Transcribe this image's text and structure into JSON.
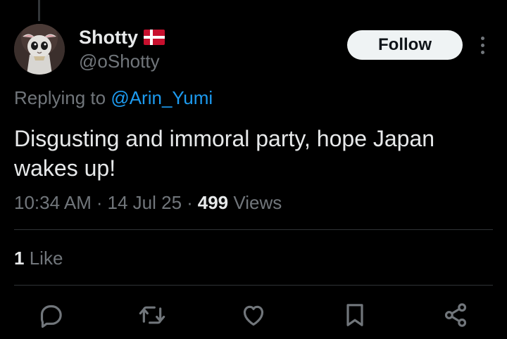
{
  "author": {
    "display_name": "Shotty",
    "flag": "🇩🇰",
    "handle": "@oShotty"
  },
  "follow_label": "Follow",
  "reply": {
    "prefix": "Replying to",
    "mention": "@Arin_Yumi"
  },
  "tweet": {
    "text": "Disgusting and immoral party, hope Japan wakes up!"
  },
  "meta": {
    "time": "10:34 AM",
    "sep1": "·",
    "date": "14 Jul 25",
    "sep2": "·",
    "views_count": "499",
    "views_label": "Views"
  },
  "engagement": {
    "likes_count": "1",
    "likes_label": "Like"
  },
  "actions": {
    "reply_icon": "reply-icon",
    "retweet_icon": "retweet-icon",
    "like_icon": "heart-icon",
    "bookmark_icon": "bookmark-icon",
    "share_icon": "share-icon"
  },
  "colors": {
    "background": "#000000",
    "text": "#e7e9ea",
    "secondary": "#71767b",
    "link": "#1d9bf0",
    "divider": "#2f3336",
    "flag_red": "#c8102e"
  }
}
